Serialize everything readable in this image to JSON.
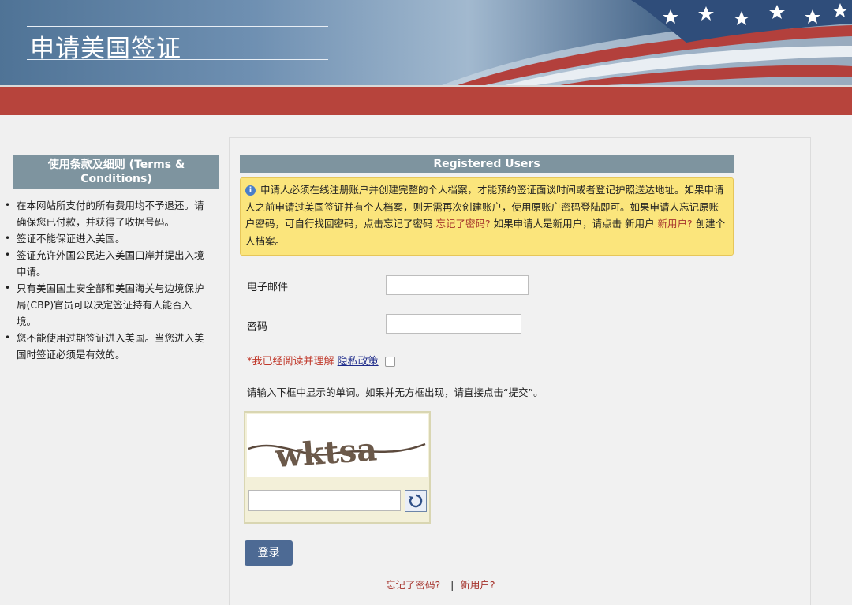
{
  "header": {
    "title": "申请美国签证"
  },
  "sidebar": {
    "heading": "使用条款及细则 (Terms & Conditions)",
    "items": [
      {
        "text": "在本网站所支付的所有费用均不予退还。请确保您已付款，并获得了收据号码。"
      },
      {
        "text": "签证不能保证进入美国。"
      },
      {
        "text": "签证允许外国公民进入美国口岸并提出入境申请。"
      },
      {
        "text": "只有美国国土安全部和美国海关与边境保护局(CBP)官员可以决定签证持有人能否入境。"
      },
      {
        "text": "您不能使用过期签证进入美国。当您进入美国时签证必须是有效的。"
      }
    ]
  },
  "main": {
    "heading": "Registered Users",
    "notice": {
      "text_1": "申请人必须在线注册账户并创建完整的个人档案，才能预约签证面谈时间或者登记护照送达地址。如果申请人之前申请过美国签证并有个人档案，则无需再次创建账户，使用原账户密码登陆即可。如果申请人忘记原账户密码，可自行找回密码，点击忘记了密码 ",
      "forgot_link": "忘记了密码?",
      "text_2": " 如果申请人是新用户，请点击 新用户 ",
      "new_user_link": "新用户?",
      "text_3": " 创建个人档案。"
    },
    "email_label": "电子邮件",
    "email_value": "",
    "password_label": "密码",
    "password_value": "",
    "agree_asterisk": "*",
    "agree_text": "我已经阅读并理解",
    "privacy_link": "隐私政策",
    "agree_checked": false,
    "captcha_hint": "请输入下框中显示的单词。如果并无方框出现，请直接点击“提交”。",
    "captcha_word": "wktsa",
    "captcha_value": "",
    "login_button": "登录",
    "bottom_forgot": "忘记了密码?",
    "bottom_sep": "|",
    "bottom_new_user": "新用户?"
  },
  "colors": {
    "header_red": "#b7443c",
    "section_heading": "#7e949f",
    "notice_bg": "#fbe57c",
    "login_button": "#4d6a94",
    "link_red": "#a5332c"
  },
  "icons": {
    "info": "info-icon",
    "refresh": "refresh-icon",
    "flag": "us-flag-image"
  }
}
